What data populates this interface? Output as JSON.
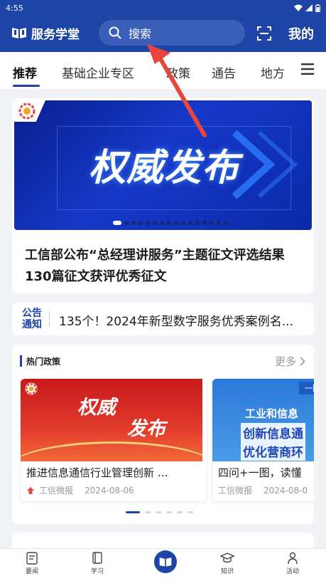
{
  "status": {
    "time": "4:55"
  },
  "header": {
    "app_name": "服务学堂",
    "search_placeholder": "搜索",
    "mine_label": "我的"
  },
  "tabs": [
    {
      "label": "推荐",
      "active": true
    },
    {
      "label": "基础企业专区",
      "active": false
    },
    {
      "label": "政策",
      "active": false
    },
    {
      "label": "通告",
      "active": false
    },
    {
      "label": "地方",
      "active": false
    }
  ],
  "banner": {
    "image_text": "权威发布",
    "caption": "工信部公布“总经理讲服务”主题征文评选结果 130篇征文获评优秀征文",
    "slide_count": 16,
    "active_slide": 0
  },
  "notice": {
    "badge_line1": "公告",
    "badge_line2": "通知",
    "text": "135个！2024年新型数字服务优秀案例名..."
  },
  "hot_policy": {
    "title": "热门政策",
    "more_label": "更多",
    "cards": [
      {
        "image_text_1": "权威",
        "image_text_2": "发布",
        "title": "推进信息通信行业管理创新 …",
        "source": "工信微报",
        "date": "2024-08-06"
      },
      {
        "image_tag": "一图",
        "image_line_1": "工业和信息",
        "image_line_2": "创新信息通",
        "image_line_3": "优化营商环",
        "title": "四问+一图，读懂",
        "source": "工信微报",
        "date": "2024-08-0"
      }
    ],
    "page_count": 6,
    "active_page": 0
  },
  "bottom_nav": [
    {
      "label": "要闻",
      "icon": "news-icon"
    },
    {
      "label": "学习",
      "icon": "book-icon"
    },
    {
      "label": "",
      "icon": "home-book-icon"
    },
    {
      "label": "知识",
      "icon": "graduation-cap-icon"
    },
    {
      "label": "活动",
      "icon": "activity-icon"
    }
  ],
  "colors": {
    "brand": "#1d44a6",
    "annotation_arrow": "#e8453c"
  }
}
